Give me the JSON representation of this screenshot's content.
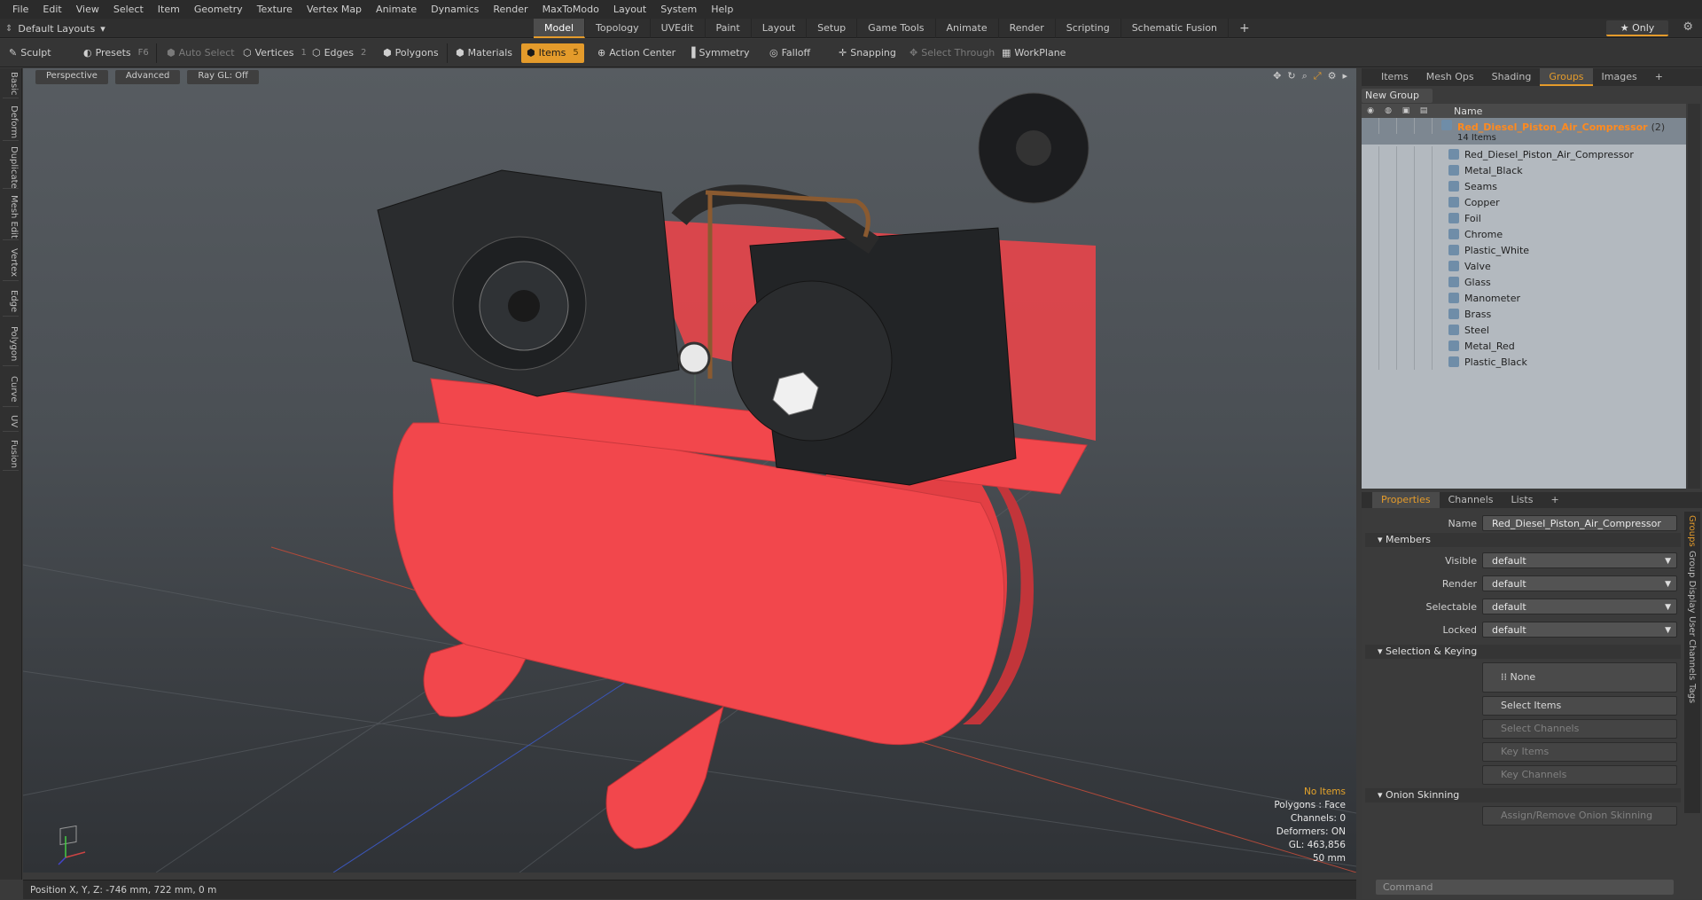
{
  "menu": [
    "File",
    "Edit",
    "View",
    "Select",
    "Item",
    "Geometry",
    "Texture",
    "Vertex Map",
    "Animate",
    "Dynamics",
    "Render",
    "MaxToModo",
    "Layout",
    "System",
    "Help"
  ],
  "layout_selector": "Default Layouts",
  "layout_tabs": [
    "Model",
    "Topology",
    "UVEdit",
    "Paint",
    "Layout",
    "Setup",
    "Game Tools",
    "Animate",
    "Render",
    "Scripting",
    "Schematic Fusion",
    "+"
  ],
  "only_label": "Only",
  "toolbar": {
    "sculpt": "Sculpt",
    "presets": "Presets",
    "presets_key": "F6",
    "auto_select": "Auto Select",
    "vertices": "Vertices",
    "vertices_key": "1",
    "edges": "Edges",
    "edges_key": "2",
    "polygons": "Polygons",
    "materials": "Materials",
    "items": "Items",
    "items_key": "5",
    "action_center": "Action Center",
    "symmetry": "Symmetry",
    "falloff": "Falloff",
    "snapping": "Snapping",
    "select_through": "Select Through",
    "workplane": "WorkPlane"
  },
  "left_tabs": [
    "Basic",
    "Deform",
    "Duplicate",
    "Mesh Edit",
    "Vertex",
    "Edge",
    "Polygon",
    "Curve",
    "UV",
    "Fusion"
  ],
  "viewport": {
    "view": "Perspective",
    "shading": "Advanced",
    "raygl": "Ray GL: Off",
    "info": {
      "no_items": "No Items",
      "polygons": "Polygons : Face",
      "channels": "Channels: 0",
      "deformers": "Deformers: ON",
      "gl": "GL: 463,856",
      "scale": "50 mm"
    }
  },
  "status": "Position X, Y, Z:  -746 mm, 722 mm, 0 m",
  "right_tabs": [
    "Items",
    "Mesh Ops",
    "Shading",
    "Groups",
    "Images",
    "+"
  ],
  "new_group": "New Group",
  "list_header": "Name",
  "group": {
    "name": "Red_Diesel_Piston_Air_Compressor",
    "count": "(2)",
    "items": "14 Items",
    "children": [
      "Red_Diesel_Piston_Air_Compressor",
      "Metal_Black",
      "Seams",
      "Copper",
      "Foil",
      "Chrome",
      "Plastic_White",
      "Valve",
      "Glass",
      "Manometer",
      "Brass",
      "Steel",
      "Metal_Red",
      "Plastic_Black"
    ]
  },
  "prop_tabs": [
    "Properties",
    "Channels",
    "Lists",
    "+"
  ],
  "props": {
    "name_label": "Name",
    "name_value": "Red_Diesel_Piston_Air_Compressor (2)",
    "members": "Members",
    "visible_label": "Visible",
    "visible": "default",
    "render_label": "Render",
    "render": "default",
    "selectable_label": "Selectable",
    "selectable": "default",
    "locked_label": "Locked",
    "locked": "default",
    "sel_keying": "Selection & Keying",
    "none": "None",
    "select_items": "Select Items",
    "select_channels": "Select Channels",
    "key_items": "Key Items",
    "key_channels": "Key Channels",
    "onion": "Onion Skinning",
    "assign_onion": "Assign/Remove Onion Skinning"
  },
  "side_tabs": [
    "Groups",
    "Group Display",
    "User Channels",
    "Tags"
  ],
  "command_placeholder": "Command",
  "colors": {
    "accent": "#e49b2b",
    "model_red": "#f2474c",
    "group_label": "#ff8a1f"
  }
}
